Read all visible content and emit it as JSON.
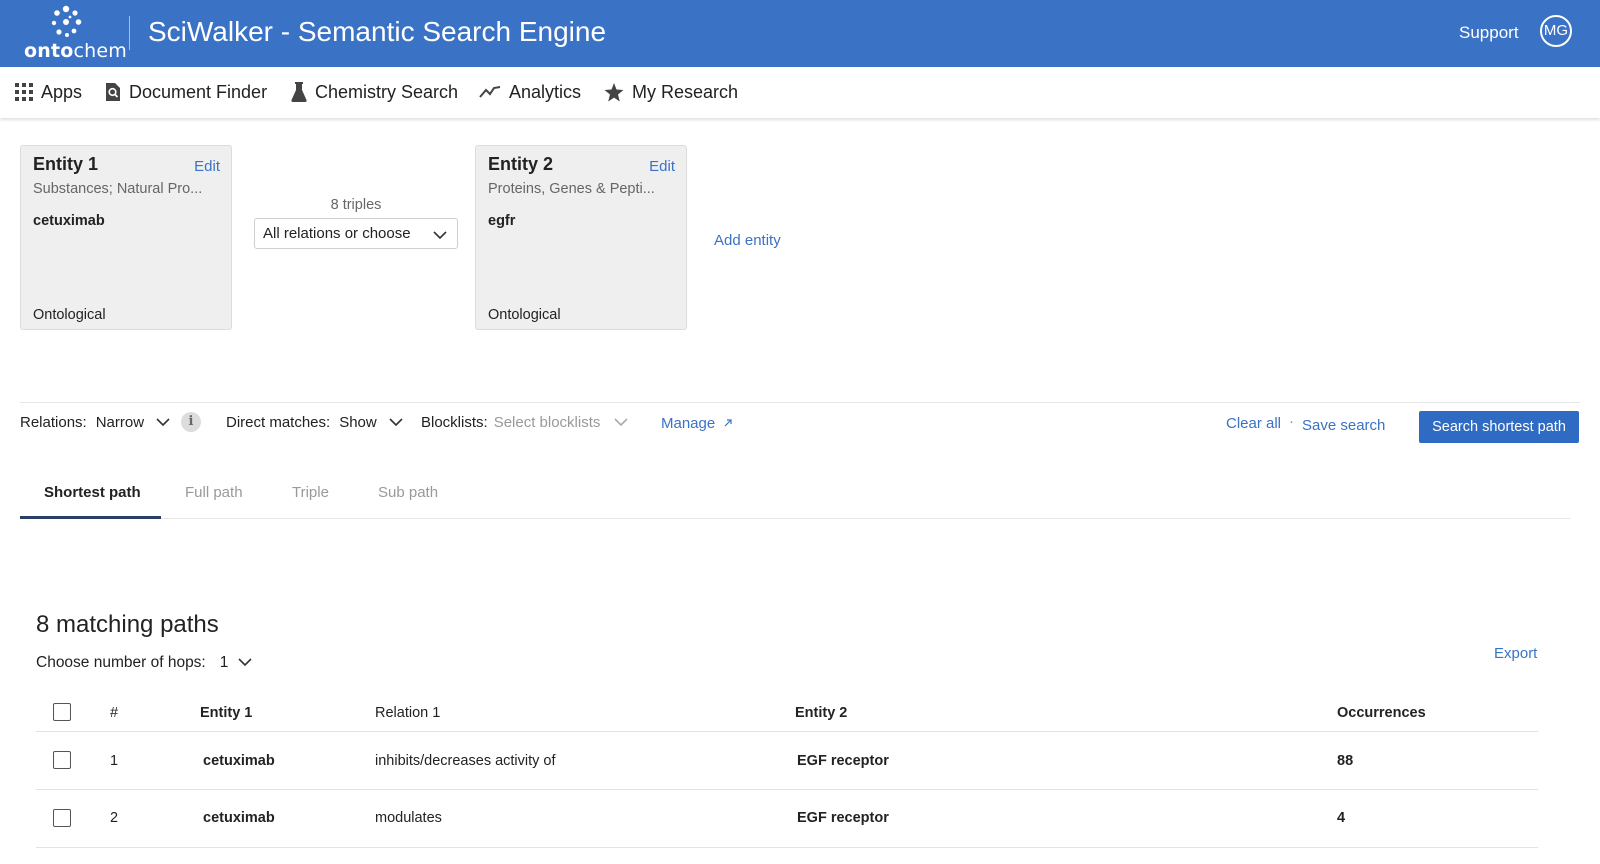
{
  "header": {
    "logo_text_bold": "onto",
    "logo_text_light": "chem",
    "title": "SciWalker - Semantic Search Engine",
    "support": "Support",
    "avatar": "MG"
  },
  "nav": {
    "apps": "Apps",
    "document_finder": "Document Finder",
    "chemistry_search": "Chemistry Search",
    "analytics": "Analytics",
    "my_research": "My Research"
  },
  "entity1": {
    "title": "Entity 1",
    "edit": "Edit",
    "category": "Substances; Natural Pro...",
    "value": "cetuximab",
    "type": "Ontological"
  },
  "relation": {
    "triples": "8 triples",
    "select": "All relations or choose"
  },
  "entity2": {
    "title": "Entity 2",
    "edit": "Edit",
    "category": "Proteins, Genes & Pepti...",
    "value": "egfr",
    "type": "Ontological"
  },
  "add_entity": "Add entity",
  "filters": {
    "relations_label": "Relations:",
    "relations_value": "Narrow",
    "info": "i",
    "direct_label": "Direct matches:",
    "direct_value": "Show",
    "blocklists_label": "Blocklists:",
    "blocklists_placeholder": "Select blocklists",
    "manage": "Manage",
    "clear_all": "Clear all",
    "separator": "·",
    "save_search": "Save search",
    "search_button": "Search shortest path"
  },
  "tabs": [
    "Shortest path",
    "Full path",
    "Triple",
    "Sub path"
  ],
  "results": {
    "title": "8 matching paths",
    "hops_label": "Choose number of hops:",
    "hops_value": "1",
    "export": "Export",
    "columns": [
      "#",
      "Entity 1",
      "Relation 1",
      "Entity 2",
      "Occurrences"
    ],
    "rows": [
      {
        "num": "1",
        "entity1": "cetuximab",
        "relation": "inhibits/decreases activity of",
        "entity2": "EGF receptor",
        "occurrences": "88"
      },
      {
        "num": "2",
        "entity1": "cetuximab",
        "relation": "modulates",
        "entity2": "EGF receptor",
        "occurrences": "4"
      }
    ]
  },
  "colors": {
    "header_bg": "#3a72c6",
    "link": "#3a72c6",
    "button_bg": "#2f6bc2",
    "tab_underline": "#2a3f66"
  }
}
